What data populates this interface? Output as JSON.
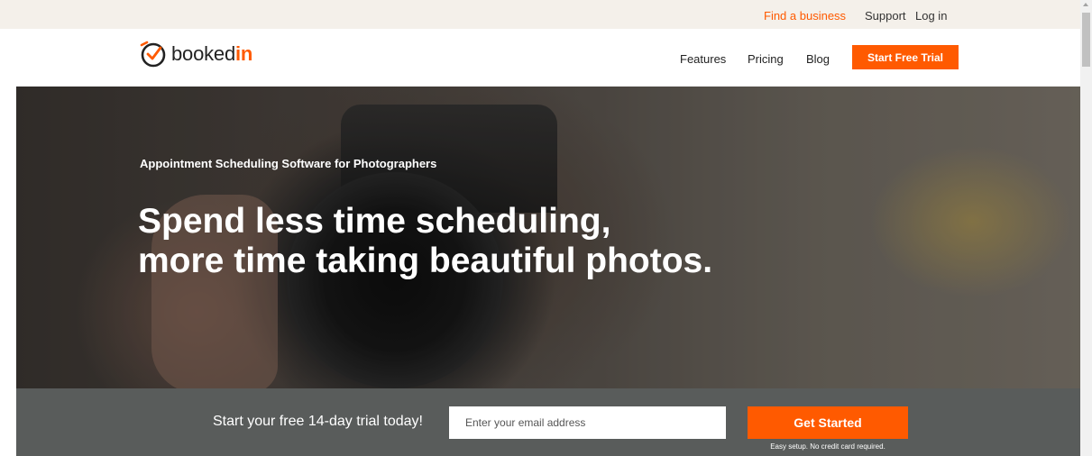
{
  "utility_bar": {
    "find_business": "Find a business",
    "support": "Support",
    "login": "Log in"
  },
  "nav": {
    "logo_text_main": "booked",
    "logo_text_accent": "in",
    "features": "Features",
    "pricing": "Pricing",
    "blog": "Blog",
    "cta": "Start Free Trial"
  },
  "hero": {
    "subtitle": "Appointment Scheduling Software for Photographers",
    "title_line1": "Spend less time scheduling,",
    "title_line2": "more time taking beautiful photos."
  },
  "signup": {
    "text": "Start your free 14-day trial today!",
    "email_placeholder": "Enter your email address",
    "button": "Get Started",
    "note": "Easy setup. No credit card required."
  },
  "colors": {
    "accent": "#ff5a00",
    "utility_bg": "#f4f0ea",
    "signup_bg": "#595c5b"
  },
  "icons": {
    "logo": "bookedin-clock-check-icon"
  }
}
